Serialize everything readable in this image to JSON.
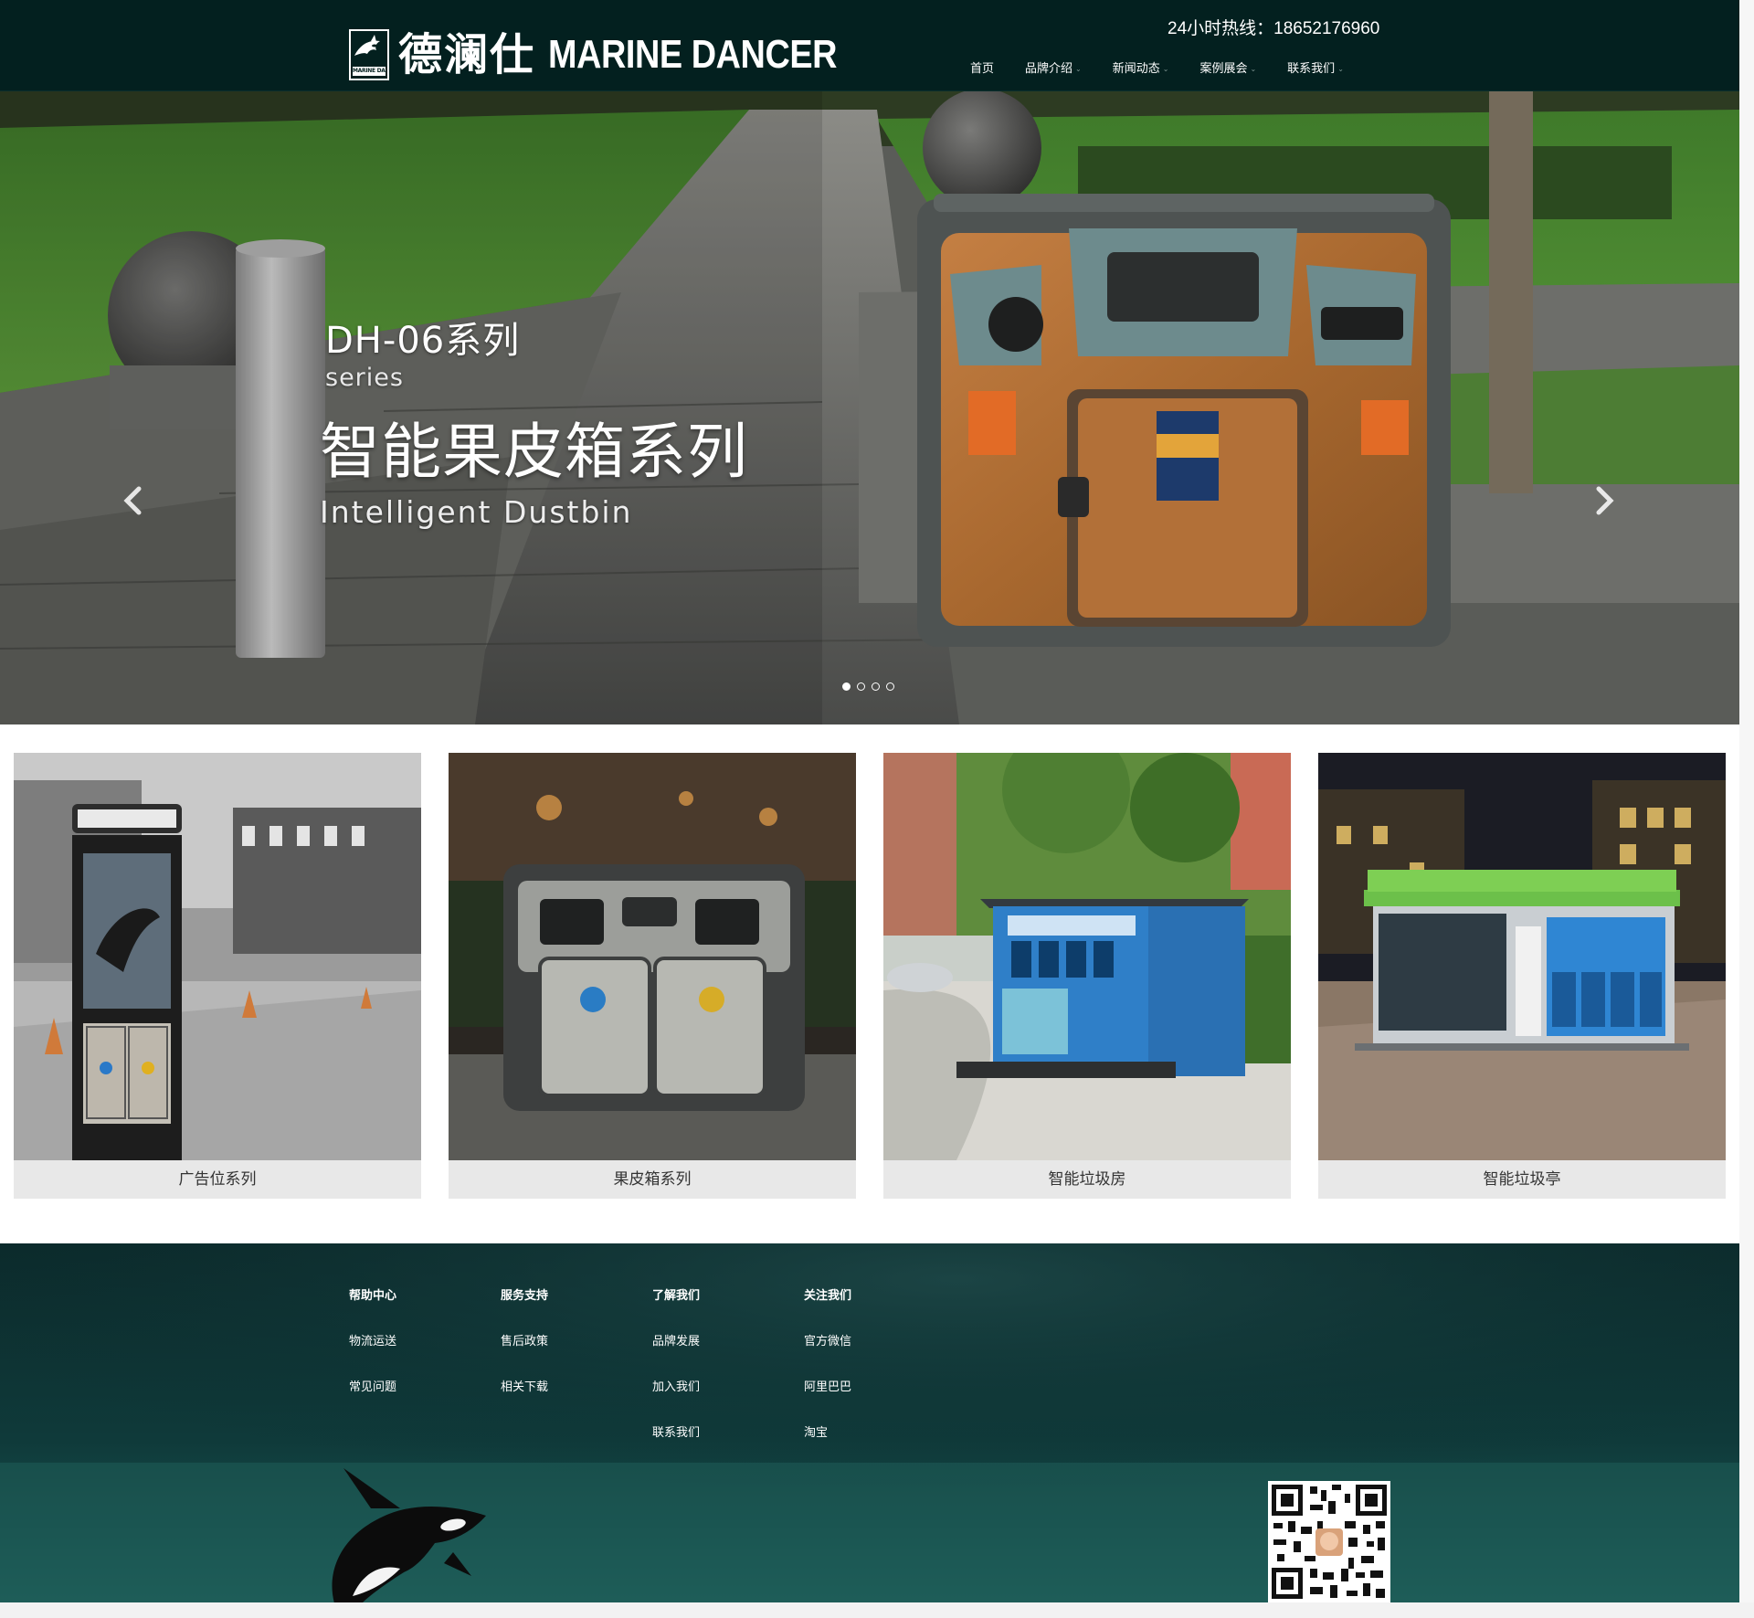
{
  "header": {
    "logo_cn": "德澜仕",
    "logo_en": "MARINE DANCER",
    "logo_badge_text": "MARINE DANCER",
    "hotline": "24小时热线：18652176960",
    "nav": [
      {
        "label": "首页"
      },
      {
        "label": "品牌介绍"
      },
      {
        "label": "新闻动态"
      },
      {
        "label": "案例展会"
      },
      {
        "label": "联系我们"
      }
    ]
  },
  "hero": {
    "series": "DH-06系列",
    "series_en": "series",
    "title": "智能果皮箱系列",
    "title_en": "Intelligent Dustbin",
    "slide_count": 4,
    "active_slide": 1
  },
  "products": [
    {
      "label": "广告位系列"
    },
    {
      "label": "果皮箱系列"
    },
    {
      "label": "智能垃圾房"
    },
    {
      "label": "智能垃圾亭"
    }
  ],
  "footer": {
    "columns": [
      {
        "title": "帮助中心",
        "links": [
          "物流运送",
          "常见问题"
        ]
      },
      {
        "title": "服务支持",
        "links": [
          "售后政策",
          "相关下载"
        ]
      },
      {
        "title": "了解我们",
        "links": [
          "品牌发展",
          "加入我们",
          "联系我们"
        ]
      },
      {
        "title": "关注我们",
        "links": [
          "官方微信",
          "阿里巴巴",
          "淘宝"
        ]
      }
    ]
  },
  "colors": {
    "header_bg": "#03201f",
    "footer_bg": "#0a2e2f",
    "card_label_bg": "#e8e8e8",
    "bin_orange": "#b3723c"
  }
}
